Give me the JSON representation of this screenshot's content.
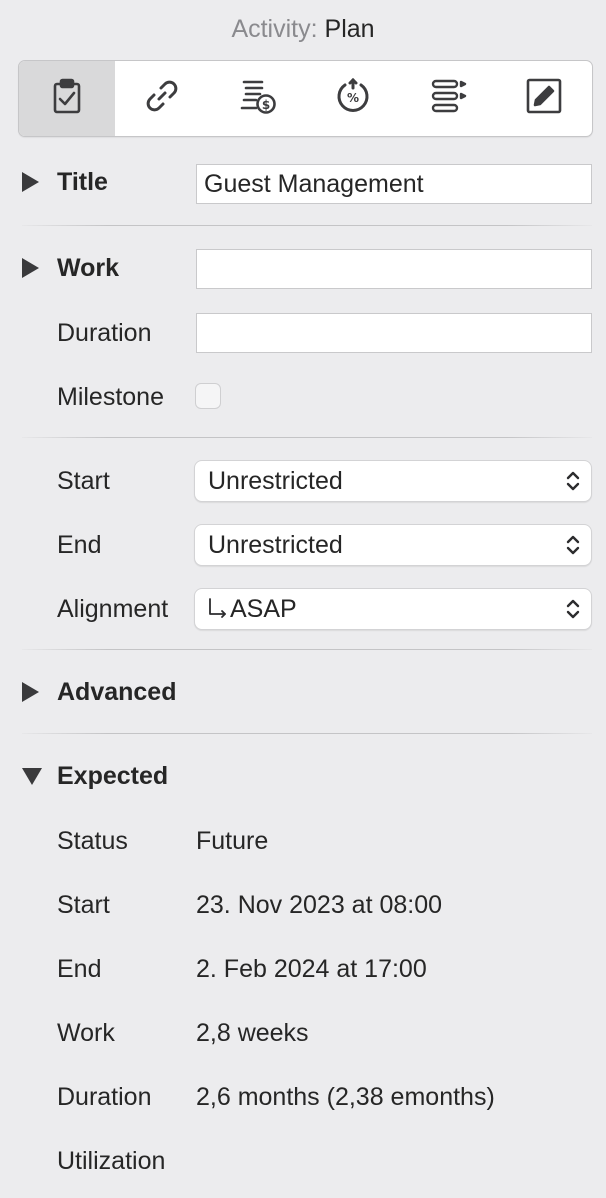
{
  "header": {
    "label": "Activity:",
    "value": "Plan"
  },
  "toolbar": {
    "tabs": [
      {
        "icon": "clipboard-check-icon",
        "active": true
      },
      {
        "icon": "link-icon",
        "active": false
      },
      {
        "icon": "cost-list-icon",
        "active": false
      },
      {
        "icon": "percent-progress-icon",
        "active": false
      },
      {
        "icon": "checklist-icon",
        "active": false
      },
      {
        "icon": "pencil-edit-icon",
        "active": false
      }
    ]
  },
  "title_section": {
    "heading": "Title",
    "value": "Guest Management"
  },
  "work_section": {
    "heading": "Work",
    "work_value": "",
    "duration_label": "Duration",
    "duration_value": "",
    "milestone_label": "Milestone",
    "milestone_checked": false
  },
  "constraints": {
    "start_label": "Start",
    "start_value": "Unrestricted",
    "end_label": "End",
    "end_value": "Unrestricted",
    "alignment_label": "Alignment",
    "alignment_value": "ASAP"
  },
  "advanced_section": {
    "heading": "Advanced"
  },
  "expected_section": {
    "heading": "Expected",
    "rows": [
      {
        "label": "Status",
        "value": "Future"
      },
      {
        "label": "Start",
        "value": "23. Nov 2023 at 08:00"
      },
      {
        "label": "End",
        "value": "2. Feb 2024 at 17:00"
      },
      {
        "label": "Work",
        "value": "2,8 weeks"
      },
      {
        "label": "Duration",
        "value": "2,6 months (2,38 emonths)"
      },
      {
        "label": "Utilization",
        "value": ""
      }
    ]
  }
}
